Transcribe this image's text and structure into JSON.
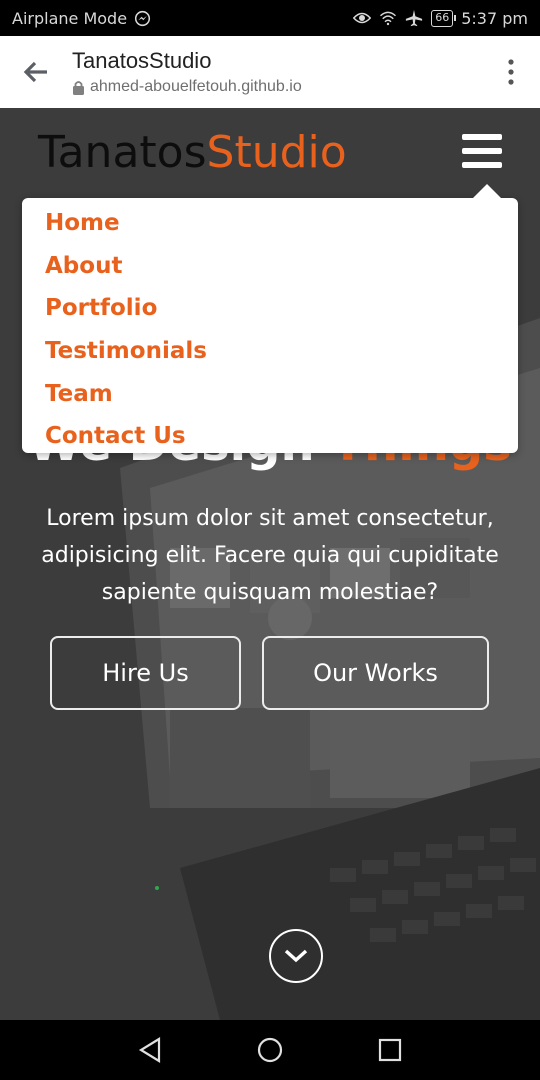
{
  "status_bar": {
    "carrier": "Airplane Mode",
    "battery": "66",
    "time": "5:37 pm",
    "icons": [
      "messenger-icon",
      "eye-icon",
      "wifi-icon",
      "airplane-icon",
      "battery-icon"
    ]
  },
  "browser": {
    "title": "TanatosStudio",
    "host": "ahmed-abouelfetouh.github.io"
  },
  "site": {
    "logo_part1": "Tanatos",
    "logo_part2": "Studio",
    "menu": [
      "Home",
      "About",
      "Portfolio",
      "Testimonials",
      "Team",
      "Contact Us"
    ],
    "hero_title_part1": "We Design ",
    "hero_title_part2": "Things",
    "hero_text": "Lorem ipsum dolor sit amet consectetur, adipisicing elit. Facere quia qui cupiditate sapiente quisquam molestiae?",
    "btn_hire": "Hire Us",
    "btn_works": "Our Works"
  },
  "colors": {
    "accent": "#e8621d",
    "hero_overlay": "#3e3e3e",
    "status_bar": "#000000",
    "url_bar": "#ffffff"
  }
}
